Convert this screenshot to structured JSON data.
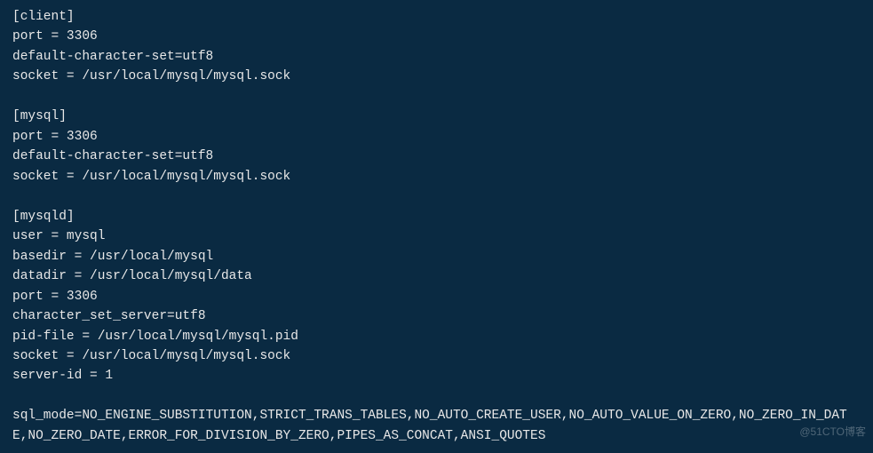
{
  "terminal": {
    "lines": [
      "[client]",
      "port = 3306",
      "default-character-set=utf8",
      "socket = /usr/local/mysql/mysql.sock",
      "",
      "[mysql]",
      "port = 3306",
      "default-character-set=utf8",
      "socket = /usr/local/mysql/mysql.sock",
      "",
      "[mysqld]",
      "user = mysql",
      "basedir = /usr/local/mysql",
      "datadir = /usr/local/mysql/data",
      "port = 3306",
      "character_set_server=utf8",
      "pid-file = /usr/local/mysql/mysql.pid",
      "socket = /usr/local/mysql/mysql.sock",
      "server-id = 1",
      "",
      "sql_mode=NO_ENGINE_SUBSTITUTION,STRICT_TRANS_TABLES,NO_AUTO_CREATE_USER,NO_AUTO_VALUE_ON_ZERO,NO_ZERO_IN_DATE,NO_ZERO_DATE,ERROR_FOR_DIVISION_BY_ZERO,PIPES_AS_CONCAT,ANSI_QUOTES"
    ]
  },
  "watermark": "@51CTO博客"
}
